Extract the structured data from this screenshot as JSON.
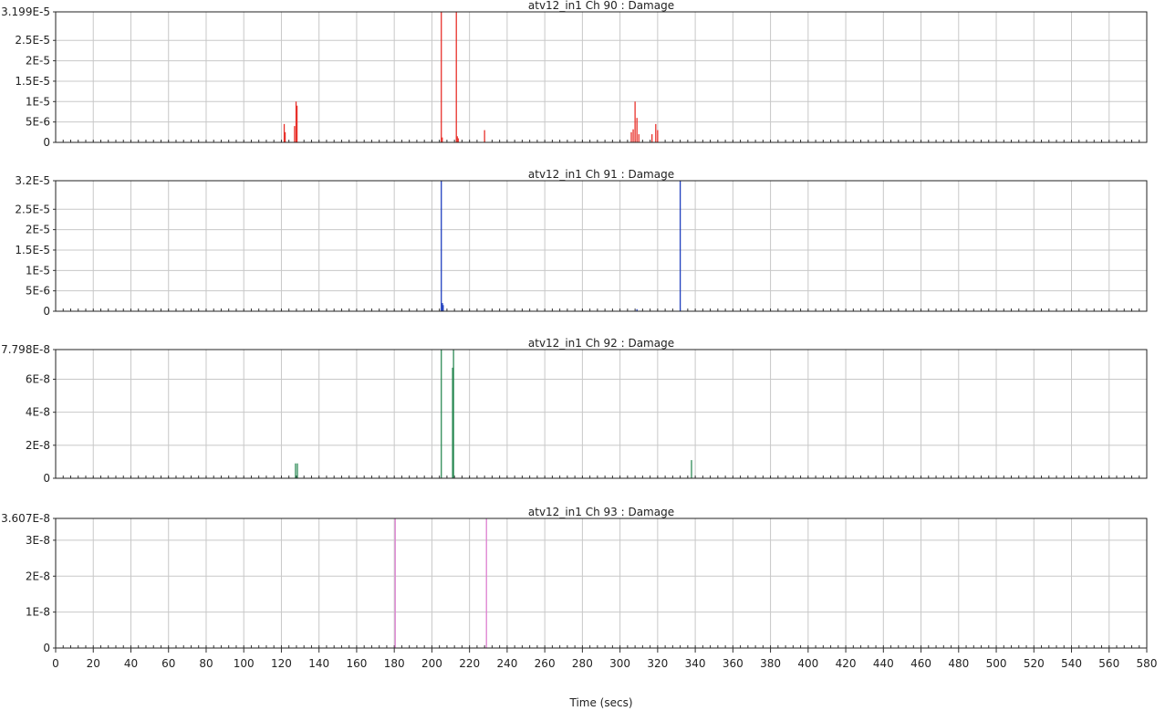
{
  "window": {
    "x_axis_label": "Time (secs)"
  },
  "chart_data": [
    {
      "type": "line",
      "title": "atv12_in1  Ch 90 : Damage",
      "series": [
        {
          "color": "#e8312b",
          "x": [
            121.5,
            122,
            127,
            127.8,
            128.3,
            205,
            205.5,
            213,
            213.5,
            214,
            228,
            306,
            307,
            308,
            309,
            310,
            317,
            319,
            320
          ],
          "y": [
            4.5e-06,
            2.5e-06,
            4e-06,
            1e-05,
            9e-06,
            3.199e-05,
            1.2e-06,
            3.199e-05,
            1.5e-06,
            1e-06,
            3e-06,
            2.5e-06,
            3.2e-06,
            1e-05,
            6e-06,
            2e-06,
            2e-06,
            4.5e-06,
            3e-06
          ]
        }
      ],
      "ylim": [
        0,
        3.199e-05
      ],
      "yticks": [
        "3.199E-5",
        "2.5E-5",
        "2E-5",
        "1.5E-5",
        "1E-5",
        "5E-6",
        "0"
      ],
      "ytick_values": [
        3.199e-05,
        2.5e-05,
        2e-05,
        1.5e-05,
        1e-05,
        5e-06,
        0
      ]
    },
    {
      "type": "line",
      "title": "atv12_in1  Ch 91 : Damage",
      "series": [
        {
          "color": "#1f3fbf",
          "x": [
            205,
            205.6,
            206,
            309,
            332
          ],
          "y": [
            3.2e-05,
            2e-06,
            1.5e-06,
            5e-07,
            3.2e-05
          ]
        }
      ],
      "ylim": [
        0,
        3.2e-05
      ],
      "yticks": [
        "3.2E-5",
        "2.5E-5",
        "2E-5",
        "1.5E-5",
        "1E-5",
        "5E-6",
        "0"
      ],
      "ytick_values": [
        3.2e-05,
        2.5e-05,
        2e-05,
        1.5e-05,
        1e-05,
        5e-06,
        0
      ]
    },
    {
      "type": "line",
      "title": "atv12_in1  Ch 92 : Damage",
      "series": [
        {
          "color": "#2e8b57",
          "x": [
            127.5,
            128.5,
            205,
            211,
            211.5,
            338
          ],
          "y": [
            9e-09,
            9e-09,
            7.798e-08,
            6.7e-08,
            7.798e-08,
            1.1e-08
          ]
        }
      ],
      "ylim": [
        0,
        7.798e-08
      ],
      "yticks": [
        "7.798E-8",
        "6E-8",
        "4E-8",
        "2E-8",
        "0"
      ],
      "ytick_values": [
        7.798e-08,
        6e-08,
        4e-08,
        2e-08,
        0
      ]
    },
    {
      "type": "line",
      "title": "atv12_in1  Ch 93 : Damage",
      "series": [
        {
          "color": "#dd7fd0",
          "x": [
            180.5,
            229
          ],
          "y": [
            3.607e-08,
            3.607e-08
          ]
        }
      ],
      "ylim": [
        0,
        3.607e-08
      ],
      "yticks": [
        "3.607E-8",
        "3E-8",
        "2E-8",
        "1E-8",
        "0"
      ],
      "ytick_values": [
        3.607e-08,
        3e-08,
        2e-08,
        1e-08,
        0
      ]
    }
  ],
  "xlim": [
    0,
    580
  ],
  "xticks": [
    "0",
    "20",
    "40",
    "60",
    "80",
    "100",
    "120",
    "140",
    "160",
    "180",
    "200",
    "220",
    "240",
    "260",
    "280",
    "300",
    "320",
    "340",
    "360",
    "380",
    "400",
    "420",
    "440",
    "460",
    "480",
    "500",
    "520",
    "540",
    "560",
    "580"
  ],
  "xlabel": "Time (secs)",
  "grid": true
}
